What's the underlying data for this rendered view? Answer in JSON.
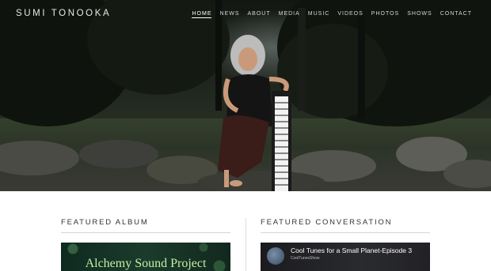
{
  "site": {
    "title": "SUMI TONOOKA"
  },
  "nav": {
    "items": [
      {
        "label": "HOME",
        "active": true
      },
      {
        "label": "NEWS"
      },
      {
        "label": "ABOUT"
      },
      {
        "label": "MEDIA"
      },
      {
        "label": "MUSIC"
      },
      {
        "label": "VIDEOS"
      },
      {
        "label": "PHOTOS"
      },
      {
        "label": "SHOWS"
      },
      {
        "label": "CONTACT"
      }
    ]
  },
  "featured_album": {
    "heading": "FEATURED ALBUM",
    "album_title": "Alchemy Sound Project"
  },
  "featured_conversation": {
    "heading": "FEATURED CONVERSATION",
    "video_title": "Cool Tunes for a Small Planet-Episode 3",
    "channel": "CoolTunesShow"
  },
  "colors": {
    "album_text": "#c4f0a2",
    "rule": "#d6d6d6",
    "heading": "#333333"
  }
}
